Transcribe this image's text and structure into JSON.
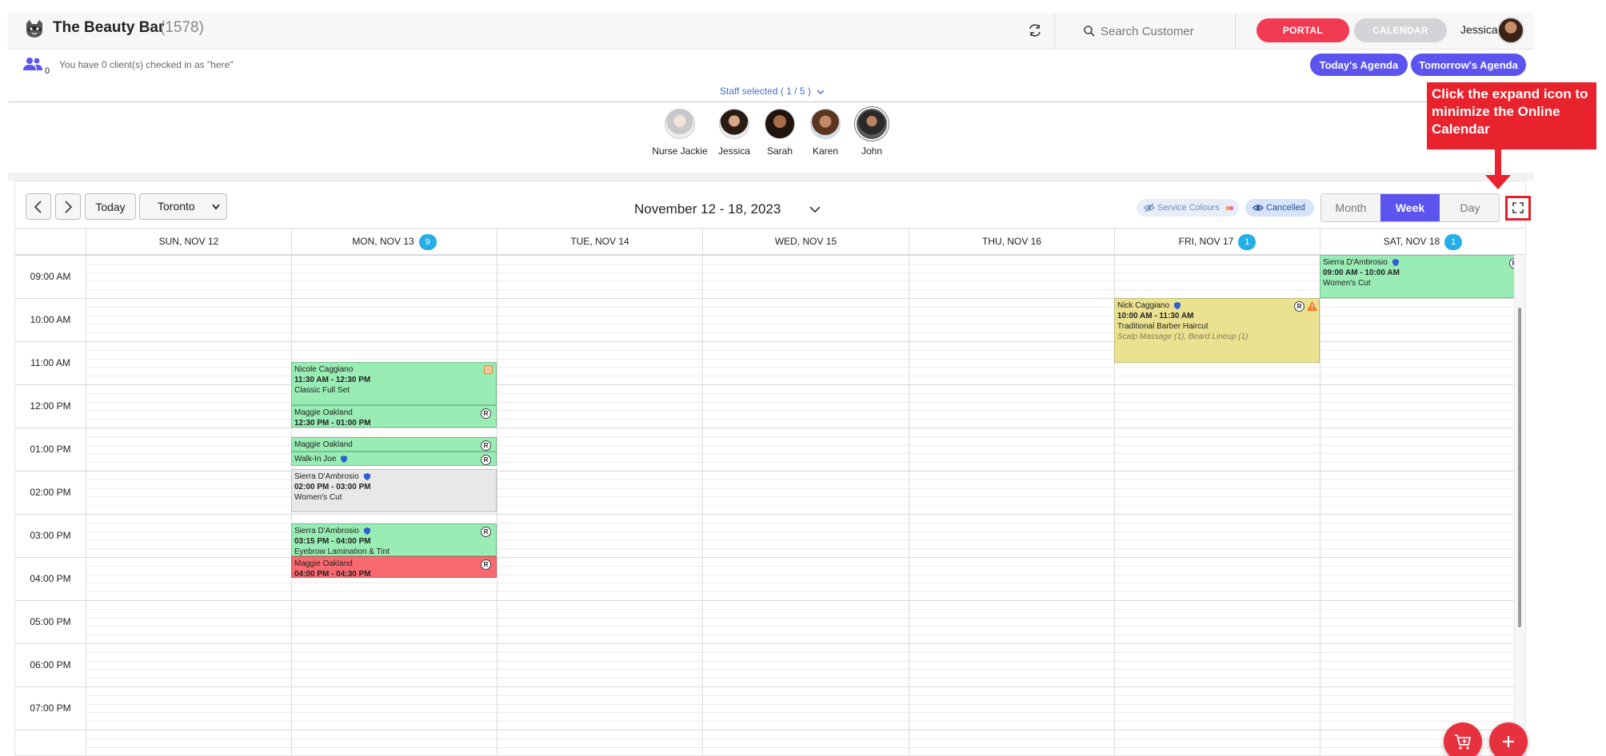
{
  "header": {
    "title": "The Beauty Bar",
    "count": "(1578)",
    "search_placeholder": "Search Customer",
    "portal_label": "PORTAL",
    "calendar_label": "CALENDAR",
    "user_name": "Jessica"
  },
  "checkin": {
    "count": "0",
    "message": "You have 0 client(s) checked in as \"here\"",
    "today_agenda": "Today's Agenda",
    "tomorrow_agenda": "Tomorrow's Agenda"
  },
  "staff_selector": {
    "label": "Staff selected ( 1 / 5 )",
    "staff": [
      {
        "name": "Nurse Jackie"
      },
      {
        "name": "Jessica"
      },
      {
        "name": "Sarah"
      },
      {
        "name": "Karen"
      },
      {
        "name": "John"
      }
    ]
  },
  "toolbar": {
    "today": "Today",
    "location": "Toronto",
    "date_range": "November 12 - 18, 2023",
    "service_colours": "Service Colours",
    "cancelled": "Cancelled",
    "views": [
      "Month",
      "Week",
      "Day"
    ],
    "active_view": "Week"
  },
  "days": [
    {
      "label": "SUN, NOV 12",
      "badge": ""
    },
    {
      "label": "MON, NOV 13",
      "badge": "9"
    },
    {
      "label": "TUE, NOV 14",
      "badge": ""
    },
    {
      "label": "WED, NOV 15",
      "badge": ""
    },
    {
      "label": "THU, NOV 16",
      "badge": ""
    },
    {
      "label": "FRI, NOV 17",
      "badge": "1"
    },
    {
      "label": "SAT, NOV 18",
      "badge": "1"
    }
  ],
  "times": [
    "09:00 AM",
    "10:00 AM",
    "11:00 AM",
    "12:00 PM",
    "01:00 PM",
    "02:00 PM",
    "03:00 PM",
    "04:00 PM",
    "05:00 PM",
    "06:00 PM",
    "07:00 PM"
  ],
  "appointments": [
    {
      "client": "Nicole Caggiano",
      "time": "11:30 AM - 12:30 PM",
      "service": "Classic Full Set",
      "extra": "",
      "color": "green",
      "badge": "gift"
    },
    {
      "client": "Maggie Oakland",
      "time": "12:30 PM - 01:00 PM",
      "service": "",
      "extra": "",
      "color": "green",
      "badge": "R"
    },
    {
      "client": "Maggie Oakland",
      "time": "",
      "service": "",
      "extra": "",
      "color": "green",
      "badge": "R"
    },
    {
      "client": "Walk-In Joe",
      "time": "",
      "service": "",
      "extra": "",
      "color": "green",
      "badge": "R"
    },
    {
      "client": "Sierra D'Ambrosio",
      "time": "02:00 PM - 03:00 PM",
      "service": "Women's Cut",
      "extra": "",
      "color": "grey",
      "badge": ""
    },
    {
      "client": "Sierra D'Ambrosio",
      "time": "03:15 PM - 04:00 PM",
      "service": "Eyebrow Lamination & Tint",
      "extra": "",
      "color": "green",
      "badge": "R"
    },
    {
      "client": "Maggie Oakland",
      "time": "04:00 PM - 04:30 PM",
      "service": "",
      "extra": "",
      "color": "red",
      "badge": "R"
    },
    {
      "client": "Nick Caggiano",
      "time": "10:00 AM - 11:30 AM",
      "service": "Traditional Barber Haircut",
      "extra": "Scalp Massage (1), Beard Lineup (1)",
      "color": "yellow",
      "badge": "R"
    },
    {
      "client": "Sierra D'Ambrosio",
      "time": "09:00 AM - 10:00 AM",
      "service": "Women's Cut",
      "extra": "",
      "color": "green",
      "badge": "R"
    }
  ],
  "callout": {
    "text": "Click the expand icon to minimize the Online Calendar"
  },
  "colors": {
    "accent": "#5b54ef",
    "portal": "#f23a53",
    "appt_green": "#98ecb4",
    "appt_red": "#f96a70",
    "appt_yellow": "#eae290",
    "callout": "#e8232d"
  }
}
